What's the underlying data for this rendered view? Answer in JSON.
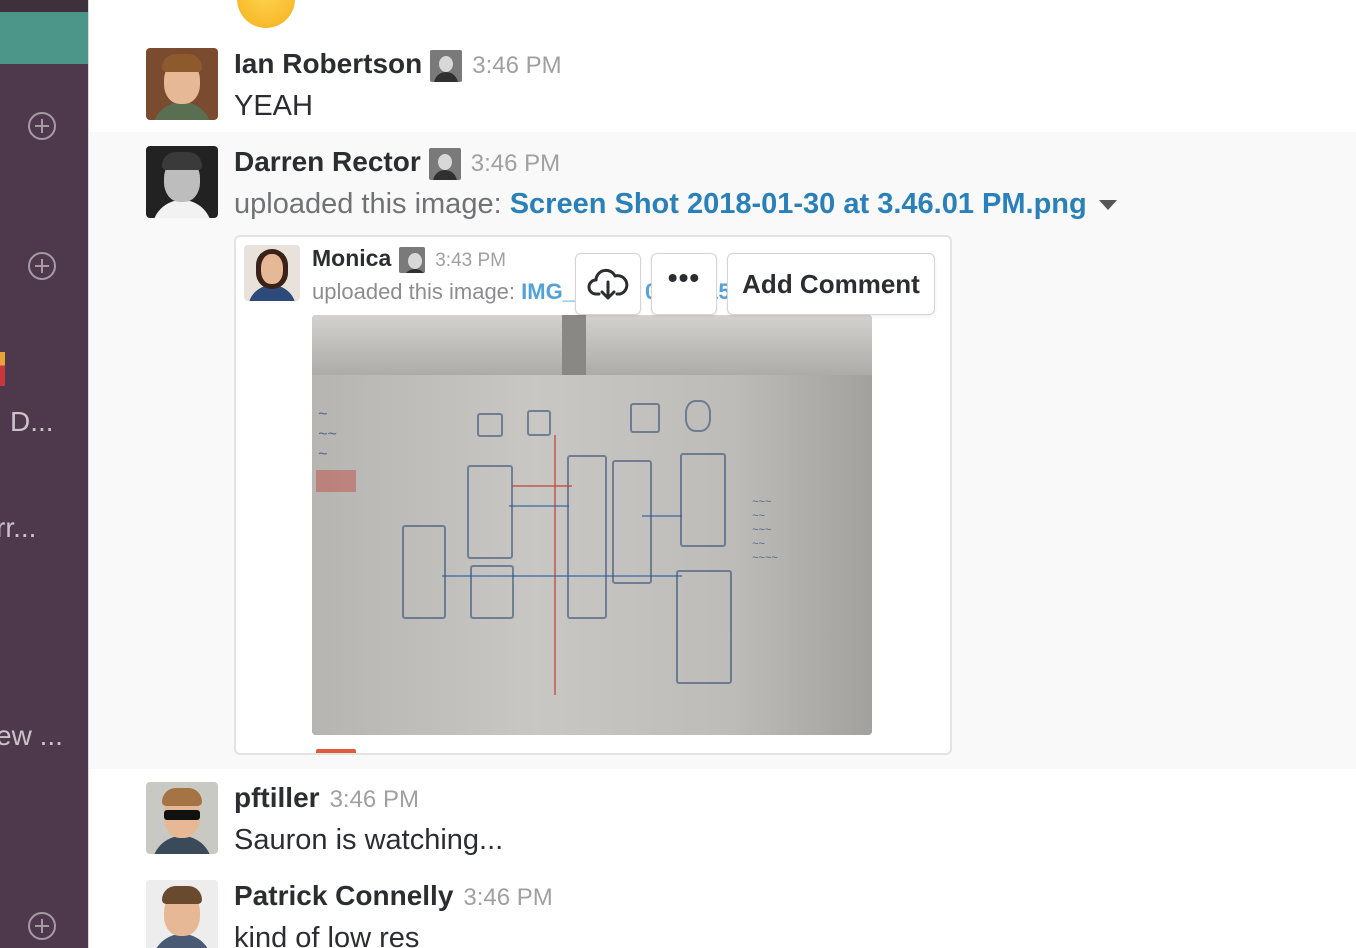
{
  "sidebar": {
    "truncated_labels": [
      "D...",
      "rr...",
      "ew ..."
    ]
  },
  "messages": [
    {
      "author": "Ian Robertson",
      "time": "3:46 PM",
      "text": "YEAH"
    },
    {
      "author": "Darren Rector",
      "time": "3:46 PM",
      "prefix": "uploaded this image: ",
      "file": "Screen Shot 2018-01-30 at 3.46.01 PM.png"
    },
    {
      "author": "pftiller",
      "time": "3:46 PM",
      "text": "Sauron is watching..."
    },
    {
      "author": "Patrick Connelly",
      "time": "3:46 PM",
      "text": "kind of low res"
    }
  ],
  "attachment": {
    "author": "Monica",
    "time": "3:43 PM",
    "prefix": "uploaded this image: ",
    "file_visible_start": "IMG_",
    "file_visible_mid": "0130_15"
  },
  "actions": {
    "download_icon": "cloud-download-icon",
    "more_label": "•••",
    "comment_label": "Add Comment"
  },
  "colors": {
    "sidebar_bg": "#4d394b",
    "active_channel": "#4c9689",
    "link": "#2a80b9",
    "highlight_bg": "#f9f9f9"
  }
}
